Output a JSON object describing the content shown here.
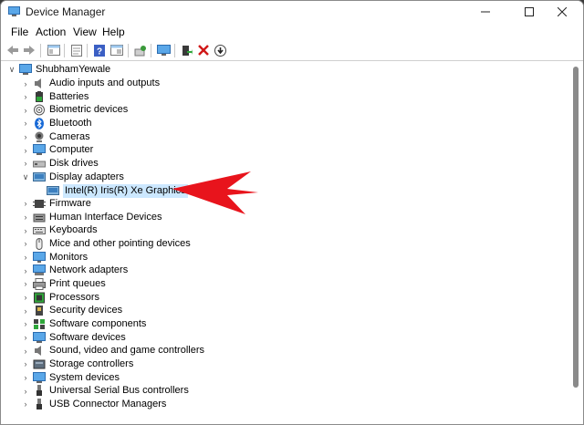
{
  "window": {
    "title": "Device Manager"
  },
  "menu": [
    "File",
    "Action",
    "View",
    "Help"
  ],
  "toolbar_icons": [
    "back-icon",
    "forward-icon",
    "show-hide-icon",
    "properties-icon",
    "help-icon",
    "view-icon",
    "scan-icon",
    "monitor-icon",
    "enable-device-icon",
    "uninstall-icon",
    "update-driver-icon"
  ],
  "tree": {
    "root": "ShubhamYewale",
    "categories": [
      {
        "label": "Audio inputs and outputs",
        "icon": "speaker-icon"
      },
      {
        "label": "Batteries",
        "icon": "battery-icon"
      },
      {
        "label": "Biometric devices",
        "icon": "fingerprint-icon"
      },
      {
        "label": "Bluetooth",
        "icon": "bluetooth-icon"
      },
      {
        "label": "Cameras",
        "icon": "camera-icon"
      },
      {
        "label": "Computer",
        "icon": "computer-icon"
      },
      {
        "label": "Disk drives",
        "icon": "disk-icon"
      },
      {
        "label": "Display adapters",
        "icon": "display-adapter-icon",
        "expanded": true,
        "children": [
          "Intel(R) Iris(R) Xe Graphics"
        ]
      },
      {
        "label": "Firmware",
        "icon": "firmware-icon"
      },
      {
        "label": "Human Interface Devices",
        "icon": "hid-icon"
      },
      {
        "label": "Keyboards",
        "icon": "keyboard-icon"
      },
      {
        "label": "Mice and other pointing devices",
        "icon": "mouse-icon"
      },
      {
        "label": "Monitors",
        "icon": "monitor-icon"
      },
      {
        "label": "Network adapters",
        "icon": "network-icon"
      },
      {
        "label": "Print queues",
        "icon": "printer-icon"
      },
      {
        "label": "Processors",
        "icon": "processor-icon"
      },
      {
        "label": "Security devices",
        "icon": "security-icon"
      },
      {
        "label": "Software components",
        "icon": "software-component-icon"
      },
      {
        "label": "Software devices",
        "icon": "software-device-icon"
      },
      {
        "label": "Sound, video and game controllers",
        "icon": "sound-icon"
      },
      {
        "label": "Storage controllers",
        "icon": "storage-icon"
      },
      {
        "label": "System devices",
        "icon": "system-icon"
      },
      {
        "label": "Universal Serial Bus controllers",
        "icon": "usb-icon"
      },
      {
        "label": "USB Connector Managers",
        "icon": "usb-connector-icon"
      }
    ]
  },
  "annotation": {
    "arrow_color": "#e8141c"
  }
}
